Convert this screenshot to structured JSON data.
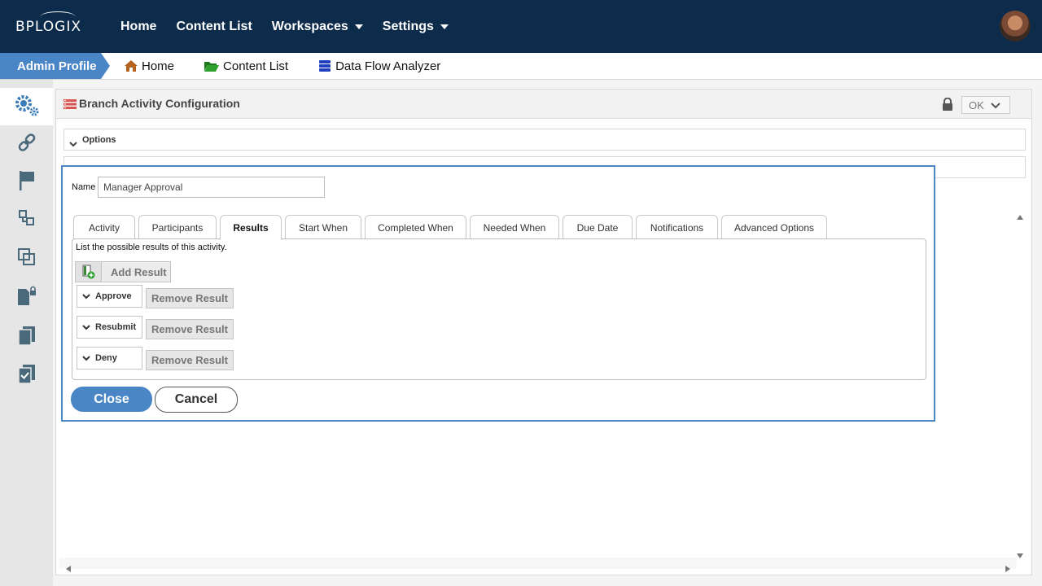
{
  "brand": {
    "logo_text": "BPLOGIX"
  },
  "topnav": {
    "items": [
      {
        "label": "Home",
        "has_dropdown": false
      },
      {
        "label": "Content List",
        "has_dropdown": false
      },
      {
        "label": "Workspaces",
        "has_dropdown": true
      },
      {
        "label": "Settings",
        "has_dropdown": true
      }
    ]
  },
  "breadcrumb": {
    "profile": "Admin Profile",
    "items": [
      {
        "label": "Home",
        "icon": "home-icon"
      },
      {
        "label": "Content List",
        "icon": "folder-icon"
      },
      {
        "label": "Data Flow Analyzer",
        "icon": "database-icon"
      }
    ]
  },
  "sidebar": {
    "items": [
      {
        "icon": "gears-icon",
        "active": true
      },
      {
        "icon": "link-icon",
        "active": false
      },
      {
        "icon": "flag-icon",
        "active": false
      },
      {
        "icon": "workflow-icon",
        "active": false
      },
      {
        "icon": "copy-icon",
        "active": false
      },
      {
        "icon": "secure-document-icon",
        "active": false
      },
      {
        "icon": "documents-icon",
        "active": false
      },
      {
        "icon": "checklist-icon",
        "active": false
      }
    ]
  },
  "panel": {
    "title": "Branch Activity Configuration",
    "ok_label": "OK",
    "sections": [
      "Options",
      ""
    ]
  },
  "dialog": {
    "name_label": "Name",
    "name_value": "Manager Approval",
    "tabs": [
      {
        "label": "Activity",
        "active": false
      },
      {
        "label": "Participants",
        "active": false
      },
      {
        "label": "Results",
        "active": true
      },
      {
        "label": "Start When",
        "active": false
      },
      {
        "label": "Completed When",
        "active": false
      },
      {
        "label": "Needed When",
        "active": false
      },
      {
        "label": "Due Date",
        "active": false
      },
      {
        "label": "Notifications",
        "active": false
      },
      {
        "label": "Advanced Options",
        "active": false
      }
    ],
    "results_description": "List the possible results of this activity.",
    "add_result_label": "Add Result",
    "results": [
      {
        "name": "Approve",
        "remove_label": "Remove Result"
      },
      {
        "name": "Resubmit",
        "remove_label": "Remove Result"
      },
      {
        "name": "Deny",
        "remove_label": "Remove Result"
      }
    ],
    "close_label": "Close",
    "cancel_label": "Cancel"
  },
  "colors": {
    "topbar": "#0d2b4b",
    "accent": "#4a86c5",
    "sidebar_bg": "#e6e6e6",
    "sidebar_icon": "#4a6a7c"
  }
}
